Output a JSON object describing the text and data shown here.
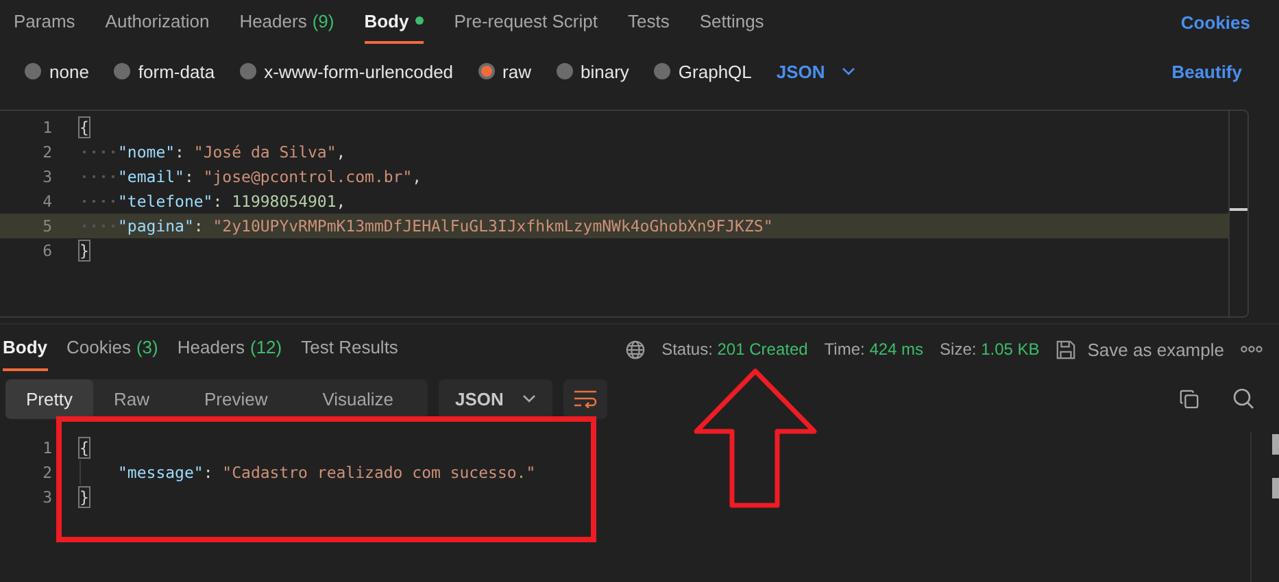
{
  "request_tabs": [
    {
      "label": "Params",
      "selected": false
    },
    {
      "label": "Authorization",
      "selected": false
    },
    {
      "label": "Headers",
      "count": "(9)",
      "selected": false
    },
    {
      "label": "Body",
      "dot": true,
      "selected": true
    },
    {
      "label": "Pre-request Script",
      "selected": false
    },
    {
      "label": "Tests",
      "selected": false
    },
    {
      "label": "Settings",
      "selected": false
    }
  ],
  "cookies_link": "Cookies",
  "body_types": [
    {
      "label": "none",
      "selected": false
    },
    {
      "label": "form-data",
      "selected": false
    },
    {
      "label": "x-www-form-urlencoded",
      "selected": false
    },
    {
      "label": "raw",
      "selected": true
    },
    {
      "label": "binary",
      "selected": false
    },
    {
      "label": "GraphQL",
      "selected": false
    }
  ],
  "body_format": "JSON",
  "beautify": "Beautify",
  "request_code": [
    {
      "number": "1",
      "indent": false,
      "highlighted": false,
      "tokens": [
        {
          "kind": "brace",
          "text": "{"
        }
      ]
    },
    {
      "number": "2",
      "indent": true,
      "highlighted": false,
      "tokens": [
        {
          "kind": "key",
          "text": "\"nome\""
        },
        {
          "kind": "punct",
          "text": ": "
        },
        {
          "kind": "string",
          "text": "\"José da Silva\""
        },
        {
          "kind": "punct",
          "text": ","
        }
      ]
    },
    {
      "number": "3",
      "indent": true,
      "highlighted": false,
      "tokens": [
        {
          "kind": "key",
          "text": "\"email\""
        },
        {
          "kind": "punct",
          "text": ": "
        },
        {
          "kind": "string",
          "text": "\"jose@pcontrol.com.br\""
        },
        {
          "kind": "punct",
          "text": ","
        }
      ]
    },
    {
      "number": "4",
      "indent": true,
      "highlighted": false,
      "tokens": [
        {
          "kind": "key",
          "text": "\"telefone\""
        },
        {
          "kind": "punct",
          "text": ": "
        },
        {
          "kind": "number",
          "text": "11998054901"
        },
        {
          "kind": "punct",
          "text": ","
        }
      ]
    },
    {
      "number": "5",
      "indent": true,
      "highlighted": true,
      "tokens": [
        {
          "kind": "key",
          "text": "\"pagina\""
        },
        {
          "kind": "punct",
          "text": ": "
        },
        {
          "kind": "string",
          "text": "\"2y10UPYvRMPmK13mmDfJEHAlFuGL3IJxfhkmLzymNWk4oGhobXn9FJKZS\""
        }
      ]
    },
    {
      "number": "6",
      "indent": false,
      "highlighted": false,
      "tokens": [
        {
          "kind": "brace",
          "text": "}"
        }
      ]
    }
  ],
  "response_tabs": [
    {
      "label": "Body",
      "selected": true
    },
    {
      "label": "Cookies",
      "count": "(3)",
      "selected": false
    },
    {
      "label": "Headers",
      "count": "(12)",
      "selected": false
    },
    {
      "label": "Test Results",
      "selected": false
    }
  ],
  "status": {
    "label": "Status:",
    "value": "201 Created"
  },
  "time": {
    "label": "Time:",
    "value": "424 ms"
  },
  "size": {
    "label": "Size:",
    "value": "1.05 KB"
  },
  "save_example": "Save as example",
  "view_tabs": [
    {
      "label": "Pretty",
      "selected": true
    },
    {
      "label": "Raw",
      "selected": false
    },
    {
      "label": "Preview",
      "selected": false
    },
    {
      "label": "Visualize",
      "selected": false
    }
  ],
  "response_format": "JSON",
  "response_code": [
    {
      "number": "1",
      "indent": false,
      "highlighted": false,
      "tokens": [
        {
          "kind": "brace",
          "text": "{"
        }
      ]
    },
    {
      "number": "2",
      "indent": true,
      "highlighted": false,
      "tokens": [
        {
          "kind": "key",
          "text": "\"message\""
        },
        {
          "kind": "punct",
          "text": ": "
        },
        {
          "kind": "string",
          "text": "\"Cadastro realizado com sucesso.\""
        }
      ]
    },
    {
      "number": "3",
      "indent": false,
      "highlighted": false,
      "tokens": [
        {
          "kind": "brace",
          "text": "}"
        }
      ]
    }
  ]
}
